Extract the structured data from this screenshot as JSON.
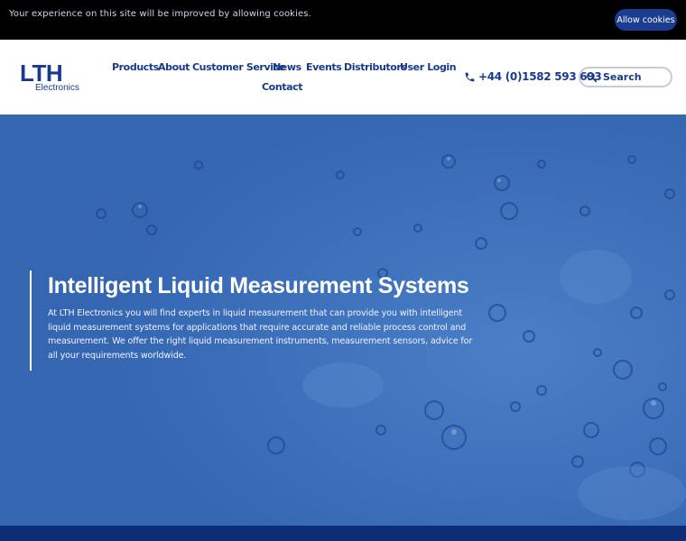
{
  "cookie_bar": {
    "message": "Your experience on this site will be improved by allowing cookies.",
    "allow_label": "Allow cookies"
  },
  "logo": {
    "mark": "LTH",
    "sub": "Electronics"
  },
  "nav": {
    "items": [
      "Products",
      "About",
      "Customer Service",
      "News",
      "Events",
      "Distributors",
      "User Login",
      "Contact"
    ]
  },
  "phone": {
    "icon": "phone-icon",
    "number": "+44 (0)1582 593 693"
  },
  "search": {
    "icon": "search-icon",
    "placeholder": "Search"
  },
  "hero": {
    "title": "Intelligent Liquid Measurement Systems",
    "description": "At LTH Electronics you will find experts in liquid measurement that can provide you with intelligent liquid measurement systems for applications that require accurate and reliable process control and measurement. We offer the right liquid measurement instruments, measurement sensors, advice for all your requirements worldwide."
  },
  "colors": {
    "brand": "#183a8c",
    "hero_blue": "#3a6cb8",
    "cookie_button": "#1a3d8f",
    "footer_band": "#0d2d78"
  }
}
